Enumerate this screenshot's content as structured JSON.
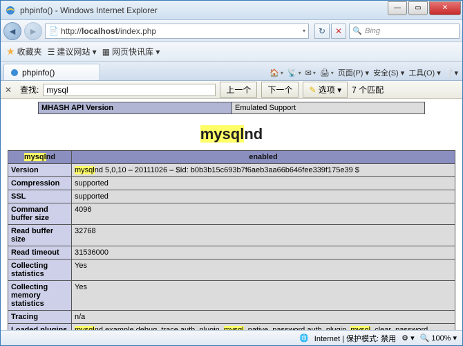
{
  "window": {
    "title": "phpinfo() - Windows Internet Explorer"
  },
  "nav": {
    "url_prefix": "http://",
    "url_host": "localhost",
    "url_path": "/index.php",
    "search_placeholder": "Bing"
  },
  "favbar": {
    "favorites": "收藏夹",
    "suggest": "建议网站 ▾",
    "quick": "网页快讯库 ▾"
  },
  "tab": {
    "title": "phpinfo()"
  },
  "toolbar": {
    "home": "🏠",
    "feed": "📡",
    "mail": "✉",
    "print": "🖨",
    "page": "页面(P) ▾",
    "safety": "安全(S) ▾",
    "tools": "工具(O) ▾",
    "help": "❔▾"
  },
  "findbar": {
    "label": "查找:",
    "value": "mysql",
    "prev": "上一个",
    "next": "下一个",
    "options": "选项 ▾",
    "matches": "7 个匹配"
  },
  "phpinfo": {
    "toprow_k": "MHASH API Version",
    "toprow_v": "Emulated Support",
    "section_hl": "mysql",
    "section_rest": "nd",
    "header_l_hl": "mysql",
    "header_l_rest": "nd",
    "header_r": "enabled",
    "rows": [
      {
        "k": "Version",
        "pre_hl": "mysql",
        "v": "nd 5,0,10 – 20111026 – $Id: b0b3b15c693b7f6aeb3aa66b646fee339f175e39 $"
      },
      {
        "k": "Compression",
        "v": "supported"
      },
      {
        "k": "SSL",
        "v": "supported"
      },
      {
        "k": "Command buffer size",
        "v": "4096"
      },
      {
        "k": "Read buffer size",
        "v": "32768"
      },
      {
        "k": "Read timeout",
        "v": "31536000"
      },
      {
        "k": "Collecting statistics",
        "v": "Yes"
      },
      {
        "k": "Collecting memory statistics",
        "v": "Yes"
      },
      {
        "k": "Tracing",
        "v": "n/a"
      }
    ],
    "loaded_k": "Loaded plugins",
    "loaded_parts": [
      "mysql",
      "nd,example,debug_trace,auth_plugin_",
      "mysql",
      "_native_password,auth_plugin_",
      "mysql",
      "_clear_password"
    ]
  },
  "status": {
    "zone": "Internet | 保护模式: 禁用",
    "zoom": "100%"
  }
}
